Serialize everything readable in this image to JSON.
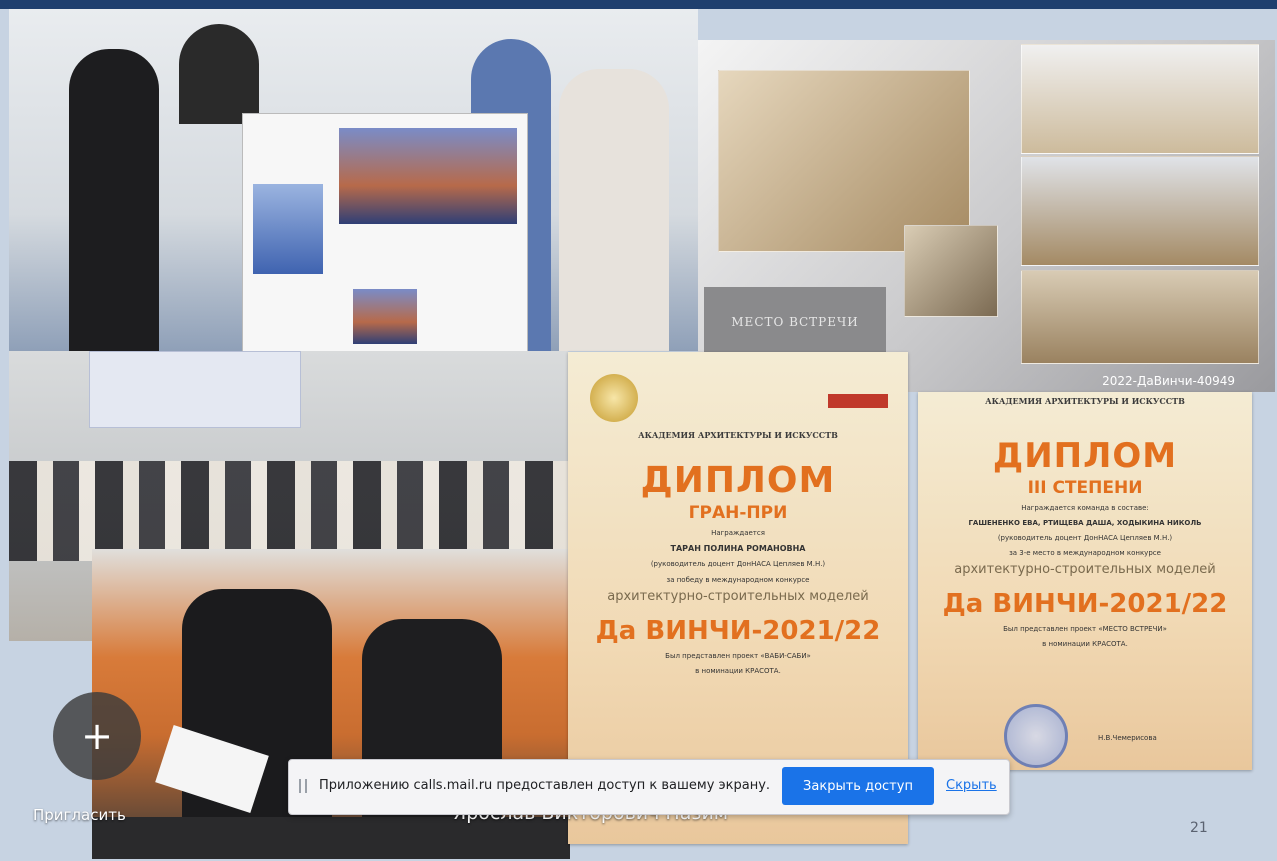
{
  "slide": {
    "number": "21",
    "model_caption": "2022-ДаВинчи-40949",
    "meeting_label": "МЕСТО ВСТРЕЧИ"
  },
  "diploma_grand_prix": {
    "academy": "АКАДЕМИЯ АРХИТЕКТУРЫ И ИСКУССТВ",
    "title": "ДИПЛОМ",
    "subtitle": "ГРАН-ПРИ",
    "awarded": "Награждается",
    "name": "ТАРАН ПОЛИНА РОМАНОВНА",
    "supervisor": "(руководитель доцент ДонНАСА Цепляев М.Н.)",
    "reason": "за победу в международном конкурсе",
    "contest": "архитектурно-строительных моделей",
    "event": "Да ВИНЧИ-2021/22",
    "project": "Был представлен проект «ВАБИ-САБИ»",
    "nomination": "в номинации КРАСОТА."
  },
  "diploma_third": {
    "academy": "АКАДЕМИЯ АРХИТЕКТУРЫ И ИСКУССТВ",
    "title": "ДИПЛОМ",
    "subtitle": "III СТЕПЕНИ",
    "awarded": "Награждается команда в составе:",
    "names": "ГАШЕНЕНКО ЕВА, РТИЩЕВА ДАША, ХОДЫКИНА НИКОЛЬ",
    "supervisor": "(руководитель доцент ДонНАСА Цепляев М.Н.)",
    "reason": "за 3-е место в международном конкурсе",
    "contest": "архитектурно-строительных моделей",
    "event": "Да ВИНЧИ-2021/22",
    "project": "Был представлен проект «МЕСТО ВСТРЕЧИ»",
    "nomination": "в номинации КРАСОТА.",
    "signer": "Н.В.Чемерисова"
  },
  "call": {
    "invite_label": "Пригласить",
    "speaker_name": "Ярослав Викторович Назим"
  },
  "share_bar": {
    "message": "Приложению calls.mail.ru предоставлен доступ к вашему экрану.",
    "stop_button": "Закрыть доступ",
    "hide_link": "Скрыть"
  },
  "colors": {
    "top_bar": "#1f3f6e",
    "diploma_accent": "#e2701f",
    "primary_button": "#1a73e8"
  }
}
